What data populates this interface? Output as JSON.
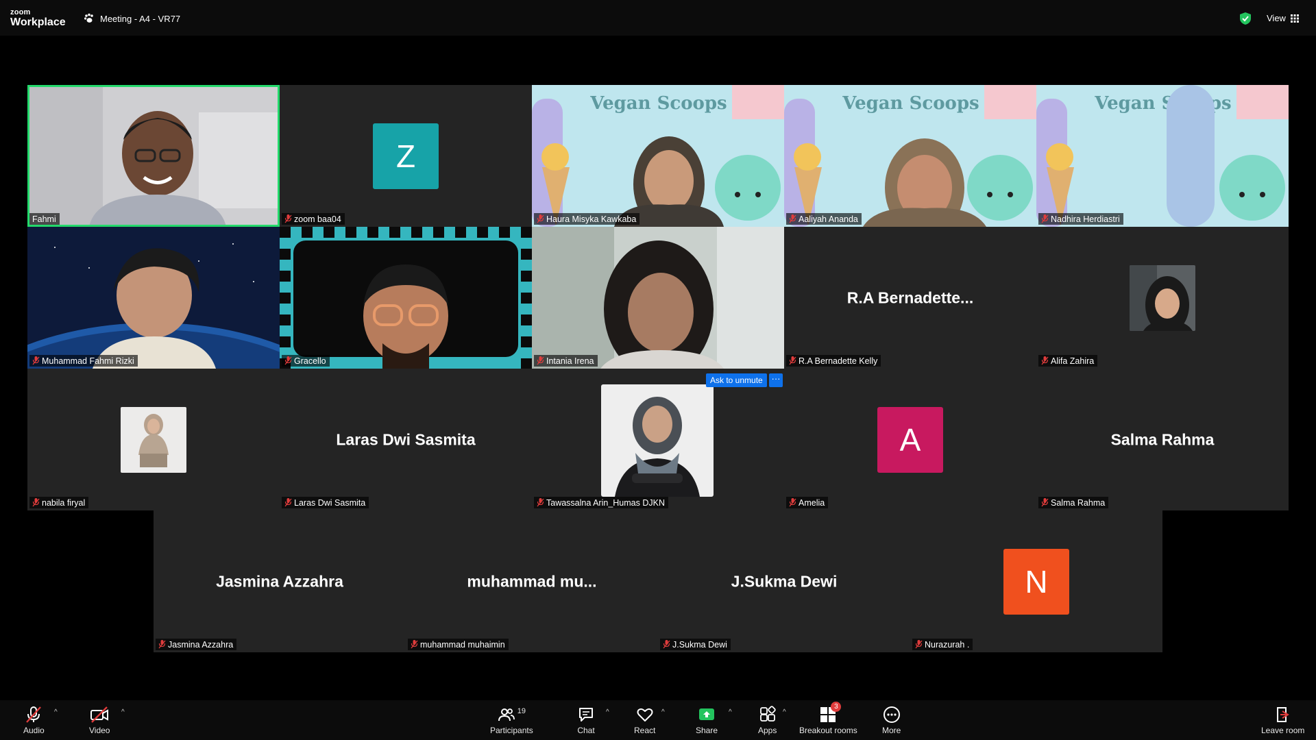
{
  "app": {
    "logo_small": "zoom",
    "logo_large": "Workplace",
    "meeting_title": "Meeting - A4 - VR77",
    "view_label": "View"
  },
  "participants": [
    {
      "name": "Fahmi",
      "kind": "video",
      "talking": true
    },
    {
      "name": "zoom baa04",
      "kind": "letter",
      "letter": "Z",
      "color": "#17a3a8"
    },
    {
      "name": "Haura Misyka Kawkaba",
      "kind": "video",
      "bg_text": "Vegan Scoops"
    },
    {
      "name": "Aaliyah Ananda",
      "kind": "video",
      "bg_text": "Vegan Scoops"
    },
    {
      "name": "Nadhira Herdiastri",
      "kind": "video",
      "bg_text": "Vegan Scoops"
    },
    {
      "name": "Muhammad Fahmi Rizki",
      "kind": "video"
    },
    {
      "name": "Gracello",
      "kind": "video"
    },
    {
      "name": "Intania Irena",
      "kind": "video"
    },
    {
      "name": "R.A Bernadette Kelly",
      "kind": "name",
      "display": "R.A  Bernadette..."
    },
    {
      "name": "Alifa Zahira",
      "kind": "photo"
    },
    {
      "name": "nabila firyal",
      "kind": "photo"
    },
    {
      "name": "Laras Dwi Sasmita",
      "kind": "name",
      "display": "Laras Dwi Sasmita"
    },
    {
      "name": "Tawassalna Arin_Humas DJKN",
      "kind": "photo"
    },
    {
      "name": "Amelia",
      "kind": "letter",
      "letter": "A",
      "color": "#c8195f"
    },
    {
      "name": "Salma Rahma",
      "kind": "name",
      "display": "Salma Rahma"
    },
    {
      "name": "Jasmina Azzahra",
      "kind": "name",
      "display": "Jasmina Azzahra"
    },
    {
      "name": "muhammad muhaimin",
      "kind": "name",
      "display": "muhammad  mu..."
    },
    {
      "name": "J.Sukma Dewi",
      "kind": "name",
      "display": "J.Sukma Dewi"
    },
    {
      "name": "Nurazurah .",
      "kind": "letter",
      "letter": "N",
      "color": "#f0501e"
    }
  ],
  "ask_to_unmute": "Ask to unmute",
  "ask_more": "···",
  "toolbar": {
    "audio": "Audio",
    "video": "Video",
    "participants": "Participants",
    "participants_count": "19",
    "chat": "Chat",
    "react": "React",
    "share": "Share",
    "apps": "Apps",
    "breakout": "Breakout rooms",
    "breakout_badge": "3",
    "more": "More",
    "leave": "Leave room"
  },
  "colors": {
    "talking_border": "#23d96b",
    "accent_blue": "#0e71eb",
    "mute_red": "#e03c3c",
    "bar_bg": "#0c0c0c",
    "tile_bg": "#242424"
  }
}
